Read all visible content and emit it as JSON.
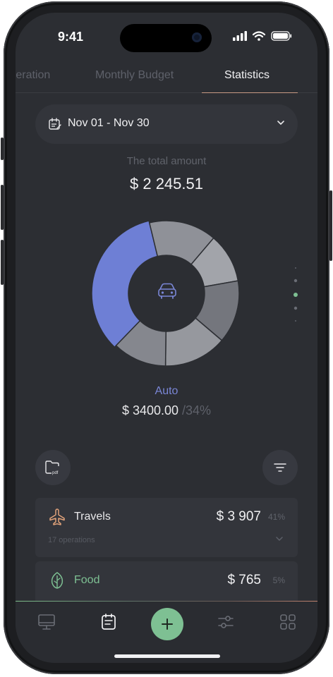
{
  "status": {
    "time": "9:41"
  },
  "tabs": [
    {
      "label": "Operation"
    },
    {
      "label": "Monthly Budget"
    },
    {
      "label": "Statistics"
    }
  ],
  "date_range": {
    "label": "Nov 01 - Nov 30"
  },
  "total": {
    "label": "The total amount",
    "amount": "$ 2 245.51"
  },
  "chart_data": {
    "type": "pie",
    "donut": true,
    "slices": [
      {
        "label": "Auto",
        "value": 34,
        "color": "#6e7fd5"
      },
      {
        "label": "",
        "value": 15,
        "color": "#8f9198"
      },
      {
        "label": "",
        "value": 11,
        "color": "#a2a4aa"
      },
      {
        "label": "",
        "value": 14,
        "color": "#74767d"
      },
      {
        "label": "",
        "value": 14,
        "color": "#96989e"
      },
      {
        "label": "",
        "value": 12,
        "color": "#85878e"
      }
    ],
    "center_icon": "car-icon"
  },
  "selected": {
    "name": "Auto",
    "value": "$ 3400.00",
    "percent": "/34%"
  },
  "actions": {
    "export_icon": "pdf-folder-icon",
    "filter_icon": "filter-icon"
  },
  "categories": [
    {
      "name": "Travels",
      "amount": "$ 3 907",
      "percent": "41%",
      "operations": "17 operations",
      "icon": "airplane-icon",
      "color": "#e0a27a"
    },
    {
      "name": "Food",
      "amount": "$ 765",
      "percent": "5%",
      "icon": "leaf-icon",
      "color": "#7ec093"
    }
  ],
  "nav": {
    "items": [
      {
        "icon": "monitor-icon"
      },
      {
        "icon": "notepad-icon"
      },
      {
        "icon": "plus-icon"
      },
      {
        "icon": "sliders-icon"
      },
      {
        "icon": "grid-icon"
      }
    ]
  },
  "colors": {
    "accent": "#7ec093",
    "tab_underline": "#c89a83",
    "auto": "#6e7fd5"
  }
}
